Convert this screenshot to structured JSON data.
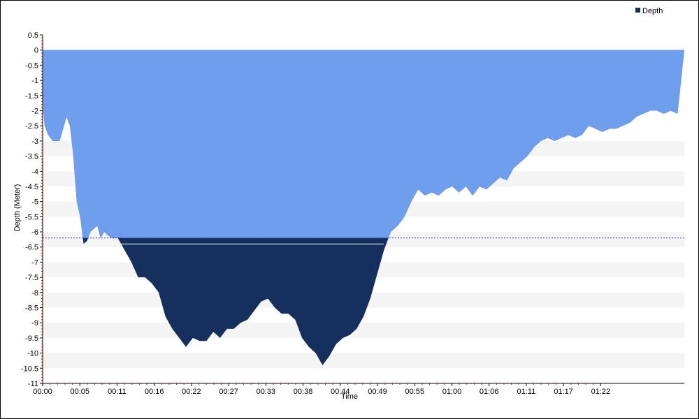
{
  "chart_data": {
    "type": "area",
    "title": "",
    "xlabel": "Time",
    "ylabel": "Depth (Meter)",
    "legend": {
      "placement": "top-right",
      "entries": [
        "Depth"
      ]
    },
    "grid": "alternating horizontal bands",
    "xlim_minutes": [
      0,
      94
    ],
    "ylim": [
      -11,
      0.5
    ],
    "x_ticks": [
      "00:00",
      "00:05",
      "00:11",
      "00:16",
      "00:22",
      "00:27",
      "00:33",
      "00:38",
      "00:44",
      "00:49",
      "00:55",
      "01:00",
      "01:06",
      "01:11",
      "01:17",
      "01:22"
    ],
    "y_ticks": [
      "0.5",
      "0",
      "-0.5",
      "-1",
      "-1.5",
      "-2",
      "-2.5",
      "-3",
      "-3.5",
      "-4",
      "-4.5",
      "-5",
      "-5.5",
      "-6",
      "-6.5",
      "-7",
      "-7.5",
      "-8",
      "-8.5",
      "-9",
      "-9.5",
      "-10",
      "-10.5",
      "-11"
    ],
    "reference_line": {
      "value": -6.2,
      "color": "#4444dd",
      "style": "dotted"
    },
    "colors": {
      "shallow": "#6f9fec",
      "deep": "#16305e",
      "band": "#f4f4f4",
      "axis": "#000000",
      "tick_mark": "#cc0000"
    },
    "series": [
      {
        "name": "Depth",
        "points": [
          [
            0,
            0
          ],
          [
            0.1,
            -2.0
          ],
          [
            0.3,
            -2.5
          ],
          [
            0.8,
            -2.8
          ],
          [
            1.5,
            -3.0
          ],
          [
            2.5,
            -3.0
          ],
          [
            3.0,
            -2.6
          ],
          [
            3.5,
            -2.2
          ],
          [
            4.0,
            -2.5
          ],
          [
            4.5,
            -3.5
          ],
          [
            5.0,
            -5.0
          ],
          [
            5.5,
            -5.5
          ],
          [
            6.0,
            -6.4
          ],
          [
            6.5,
            -6.3
          ],
          [
            7.0,
            -6.0
          ],
          [
            8.0,
            -5.8
          ],
          [
            8.5,
            -6.2
          ],
          [
            9.0,
            -6.0
          ],
          [
            10.0,
            -6.2
          ],
          [
            11.0,
            -6.2
          ],
          [
            12.0,
            -6.6
          ],
          [
            13.0,
            -7.0
          ],
          [
            14.0,
            -7.5
          ],
          [
            15.0,
            -7.5
          ],
          [
            16.0,
            -7.7
          ],
          [
            17.0,
            -8.0
          ],
          [
            18.0,
            -8.8
          ],
          [
            19.0,
            -9.2
          ],
          [
            20.0,
            -9.5
          ],
          [
            21.0,
            -9.8
          ],
          [
            22.0,
            -9.5
          ],
          [
            23.0,
            -9.6
          ],
          [
            24.0,
            -9.6
          ],
          [
            25.0,
            -9.3
          ],
          [
            26.0,
            -9.5
          ],
          [
            27.0,
            -9.2
          ],
          [
            28.0,
            -9.2
          ],
          [
            29.0,
            -9.0
          ],
          [
            30.0,
            -8.9
          ],
          [
            31.0,
            -8.6
          ],
          [
            32.0,
            -8.3
          ],
          [
            33.0,
            -8.2
          ],
          [
            34.0,
            -8.5
          ],
          [
            35.0,
            -8.7
          ],
          [
            36.0,
            -8.7
          ],
          [
            37.0,
            -8.9
          ],
          [
            38.0,
            -9.5
          ],
          [
            39.0,
            -9.8
          ],
          [
            40.0,
            -10.0
          ],
          [
            41.0,
            -10.4
          ],
          [
            42.0,
            -10.1
          ],
          [
            43.0,
            -9.7
          ],
          [
            44.0,
            -9.5
          ],
          [
            45.0,
            -9.4
          ],
          [
            46.0,
            -9.2
          ],
          [
            47.0,
            -8.8
          ],
          [
            48.0,
            -8.2
          ],
          [
            49.0,
            -7.4
          ],
          [
            50.0,
            -6.6
          ],
          [
            51.0,
            -6.0
          ],
          [
            52.0,
            -5.8
          ],
          [
            53.0,
            -5.5
          ],
          [
            54.0,
            -5.0
          ],
          [
            55.0,
            -4.6
          ],
          [
            56.0,
            -4.8
          ],
          [
            57.0,
            -4.7
          ],
          [
            58.0,
            -4.8
          ],
          [
            59.0,
            -4.6
          ],
          [
            60.0,
            -4.5
          ],
          [
            61.0,
            -4.7
          ],
          [
            62.0,
            -4.5
          ],
          [
            63.0,
            -4.8
          ],
          [
            64.0,
            -4.5
          ],
          [
            65.0,
            -4.6
          ],
          [
            66.0,
            -4.4
          ],
          [
            67.0,
            -4.2
          ],
          [
            68.0,
            -4.3
          ],
          [
            69.0,
            -3.9
          ],
          [
            70.0,
            -3.7
          ],
          [
            71.0,
            -3.5
          ],
          [
            72.0,
            -3.2
          ],
          [
            73.0,
            -3.0
          ],
          [
            74.0,
            -2.9
          ],
          [
            75.0,
            -3.0
          ],
          [
            76.0,
            -2.9
          ],
          [
            77.0,
            -2.8
          ],
          [
            78.0,
            -2.9
          ],
          [
            79.0,
            -2.8
          ],
          [
            80.0,
            -2.5
          ],
          [
            81.0,
            -2.6
          ],
          [
            82.0,
            -2.7
          ],
          [
            83.0,
            -2.6
          ],
          [
            84.0,
            -2.6
          ],
          [
            85.0,
            -2.5
          ],
          [
            86.0,
            -2.4
          ],
          [
            87.0,
            -2.2
          ],
          [
            88.0,
            -2.1
          ],
          [
            89.0,
            -2.0
          ],
          [
            90.0,
            -2.0
          ],
          [
            91.0,
            -2.1
          ],
          [
            92.0,
            -2.0
          ],
          [
            93.0,
            -2.1
          ],
          [
            94.0,
            0
          ]
        ]
      }
    ]
  }
}
